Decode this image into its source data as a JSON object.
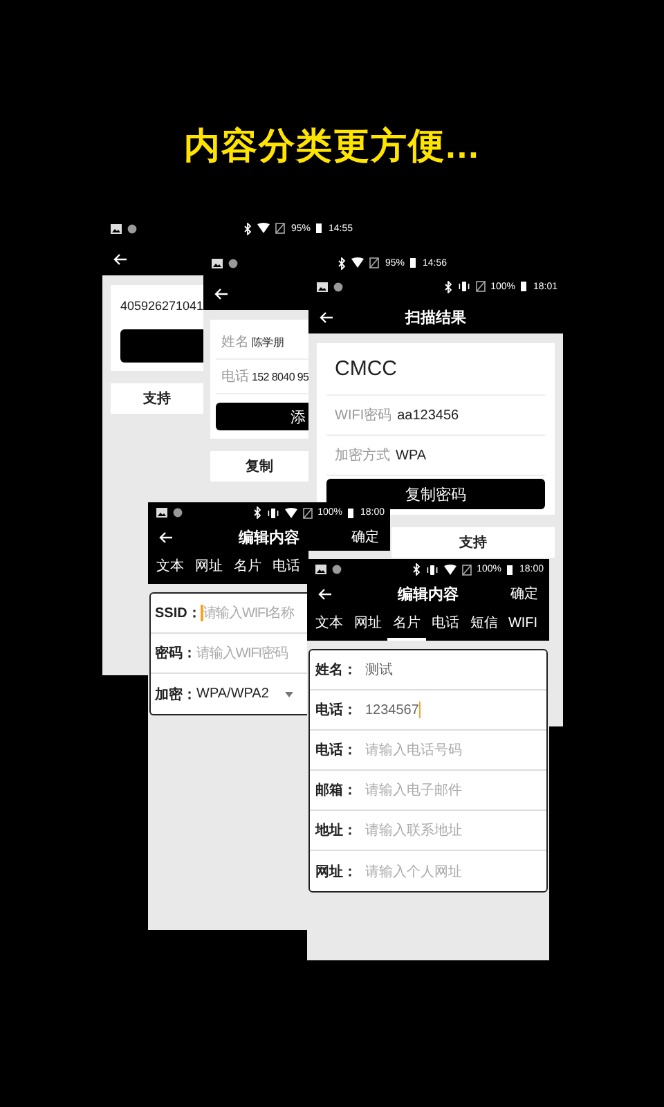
{
  "headline": "内容分类更方便...",
  "screens": [
    {
      "kind": "result",
      "status": {
        "vibrate": false,
        "wifi": true,
        "battery": "95%",
        "time": "14:55"
      },
      "blocks": [
        {
          "kind": "card",
          "items": [
            {
              "kind": "text",
              "text": "405926271041"
            },
            {
              "kind": "dark_button"
            }
          ]
        },
        {
          "kind": "light_button",
          "label": "支持"
        }
      ]
    },
    {
      "kind": "result",
      "status": {
        "vibrate": false,
        "wifi": true,
        "battery": "95%",
        "time": "14:56"
      },
      "blocks": [
        {
          "kind": "card",
          "items": [
            {
              "kind": "pair",
              "label": "姓名",
              "value": "陈学朋"
            },
            {
              "kind": "pair",
              "label": "电话",
              "value": "152 8040 95"
            },
            {
              "kind": "dark_button",
              "label": "添"
            }
          ]
        },
        {
          "kind": "light_button",
          "label": "复制"
        }
      ]
    },
    {
      "kind": "result",
      "status": {
        "vibrate": true,
        "wifi": false,
        "battery": "100%",
        "time": "18:01"
      },
      "app_bar": {
        "title": "扫描结果"
      },
      "blocks": [
        {
          "kind": "card",
          "items": [
            {
              "kind": "heading",
              "text": "CMCC"
            },
            {
              "kind": "pair",
              "label": "WIFI密码",
              "value": "aa123456"
            },
            {
              "kind": "pair",
              "label": "加密方式",
              "value": "WPA"
            },
            {
              "kind": "dark_button",
              "label": "复制密码"
            }
          ]
        },
        {
          "kind": "light_button",
          "label": "支持"
        }
      ]
    },
    {
      "kind": "edit",
      "status": {
        "vibrate": true,
        "wifi": true,
        "battery": "100%",
        "time": "18:00"
      },
      "app_bar": {
        "title": "编辑内容",
        "action": "确定"
      },
      "tabs": [
        {
          "label": "文本",
          "selected": false
        },
        {
          "label": "网址",
          "selected": false
        },
        {
          "label": "名片",
          "selected": false
        },
        {
          "label": "电话",
          "selected": false
        }
      ],
      "fields": [
        {
          "kind": "input",
          "label": "SSID：",
          "placeholder": "请输入WIFI名称",
          "focused": true
        },
        {
          "kind": "input",
          "label": "密码：",
          "placeholder": "请输入WIFI密码",
          "focused": false
        },
        {
          "kind": "select",
          "label": "加密：",
          "value": "WPA/WPA2",
          "focused": false
        }
      ]
    },
    {
      "kind": "edit",
      "status": {
        "vibrate": true,
        "wifi": true,
        "battery": "100%",
        "time": "18:00"
      },
      "app_bar": {
        "title": "编辑内容",
        "action": "确定"
      },
      "tabs": [
        {
          "label": "文本",
          "selected": false
        },
        {
          "label": "网址",
          "selected": false
        },
        {
          "label": "名片",
          "selected": true
        },
        {
          "label": "电话",
          "selected": false
        },
        {
          "label": "短信",
          "selected": false
        },
        {
          "label": "WIFI",
          "selected": false
        }
      ],
      "fields": [
        {
          "kind": "input",
          "label": "姓名：",
          "value": "测试",
          "focused": false
        },
        {
          "kind": "input",
          "label": "电话：",
          "value": "1234567",
          "focused": true
        },
        {
          "kind": "input",
          "label": "电话：",
          "placeholder": "请输入电话号码",
          "focused": false
        },
        {
          "kind": "input",
          "label": "邮箱：",
          "placeholder": "请输入电子邮件",
          "focused": false
        },
        {
          "kind": "input",
          "label": "地址：",
          "placeholder": "请输入联系地址",
          "focused": false
        },
        {
          "kind": "input",
          "label": "网址：",
          "placeholder": "请输入个人网址",
          "focused": false
        }
      ]
    }
  ]
}
